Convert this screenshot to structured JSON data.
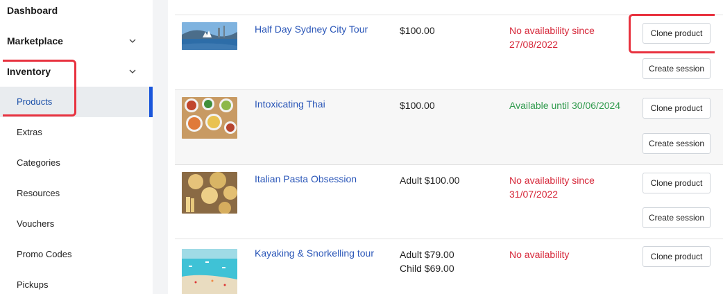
{
  "sidebar": {
    "top_items": [
      {
        "label": "Dashboard"
      },
      {
        "label": "Marketplace"
      },
      {
        "label": "Inventory"
      }
    ],
    "sub_items": [
      {
        "label": "Products",
        "active": true
      },
      {
        "label": "Extras"
      },
      {
        "label": "Categories"
      },
      {
        "label": "Resources"
      },
      {
        "label": "Vouchers"
      },
      {
        "label": "Promo Codes"
      },
      {
        "label": "Pickups"
      }
    ]
  },
  "products": [
    {
      "name": "Half Day Sydney City Tour",
      "price_lines": [
        "$100.00"
      ],
      "availability": "No availability since 27/08/2022",
      "availability_status": "unavailable",
      "buttons": {
        "clone": "Clone product",
        "session": "Create session"
      },
      "thumbnail": "sydney-harbour-photo"
    },
    {
      "name": "Intoxicating Thai",
      "price_lines": [
        "$100.00"
      ],
      "availability": "Available until 30/06/2024",
      "availability_status": "available",
      "buttons": {
        "clone": "Clone product",
        "session": "Create session"
      },
      "thumbnail": "thai-food-photo"
    },
    {
      "name": "Italian Pasta Obsession",
      "price_lines": [
        "Adult $100.00"
      ],
      "availability": "No availability since 31/07/2022",
      "availability_status": "unavailable",
      "buttons": {
        "clone": "Clone product",
        "session": "Create session"
      },
      "thumbnail": "pasta-photo"
    },
    {
      "name": "Kayaking & Snorkelling tour",
      "price_lines": [
        "Adult $79.00",
        "Child $69.00"
      ],
      "availability": "No availability",
      "availability_status": "unavailable",
      "buttons": {
        "clone": "Clone product"
      },
      "thumbnail": "beach-photo"
    }
  ],
  "colors": {
    "link": "#2a56b8",
    "unavailable": "#d6283a",
    "available": "#2f9a4c",
    "active_indicator": "#1a56db",
    "annotation": "#e8323f"
  }
}
